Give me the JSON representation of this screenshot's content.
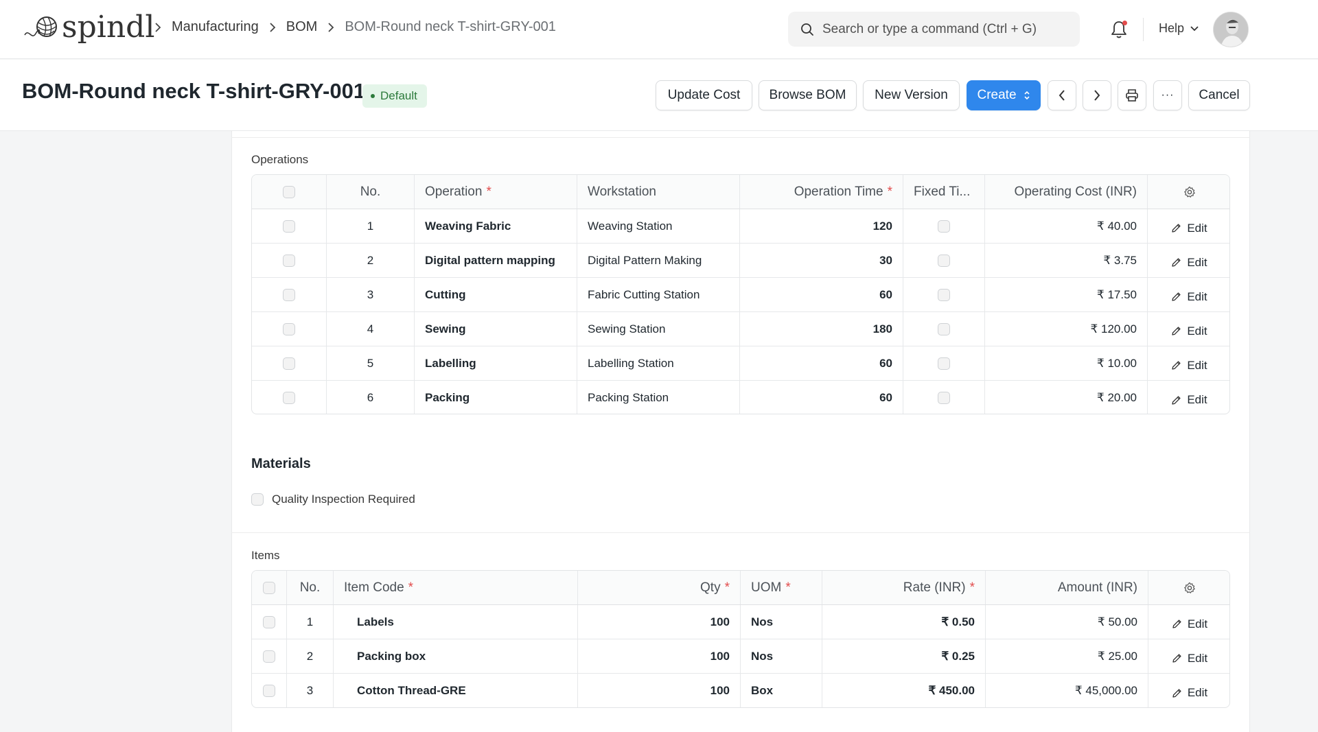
{
  "app": {
    "logo_text": "spindl"
  },
  "breadcrumbs": [
    "Manufacturing",
    "BOM",
    "BOM-Round neck T-shirt-GRY-001"
  ],
  "search": {
    "placeholder": "Search or type a command (Ctrl + G)"
  },
  "nav": {
    "help_label": "Help"
  },
  "header": {
    "title": "BOM-Round neck T-shirt-GRY-001",
    "status_badge": "Default",
    "buttons": {
      "update_cost": "Update Cost",
      "browse_bom": "Browse BOM",
      "new_version": "New Version",
      "create": "Create",
      "cancel": "Cancel",
      "more": "···"
    }
  },
  "operations": {
    "label": "Operations",
    "columns": {
      "no": "No.",
      "operation": "Operation",
      "workstation": "Workstation",
      "operation_time": "Operation Time",
      "fixed_time": "Fixed Ti...",
      "operating_cost": "Operating Cost (INR)"
    },
    "edit_label": "Edit",
    "rows": [
      {
        "no": "1",
        "operation": "Weaving Fabric",
        "workstation": "Weaving Station",
        "time": "120",
        "cost": "₹ 40.00"
      },
      {
        "no": "2",
        "operation": "Digital pattern mapping",
        "workstation": "Digital Pattern Making",
        "time": "30",
        "cost": "₹ 3.75"
      },
      {
        "no": "3",
        "operation": "Cutting",
        "workstation": "Fabric Cutting Station",
        "time": "60",
        "cost": "₹ 17.50"
      },
      {
        "no": "4",
        "operation": "Sewing",
        "workstation": "Sewing Station",
        "time": "180",
        "cost": "₹ 120.00"
      },
      {
        "no": "5",
        "operation": "Labelling",
        "workstation": "Labelling Station",
        "time": "60",
        "cost": "₹ 10.00"
      },
      {
        "no": "6",
        "operation": "Packing",
        "workstation": "Packing Station",
        "time": "60",
        "cost": "₹ 20.00"
      }
    ]
  },
  "materials": {
    "title": "Materials",
    "quality_inspection_label": "Quality Inspection Required"
  },
  "items": {
    "label": "Items",
    "columns": {
      "no": "No.",
      "item_code": "Item Code",
      "qty": "Qty",
      "uom": "UOM",
      "rate": "Rate (INR)",
      "amount": "Amount (INR)"
    },
    "edit_label": "Edit",
    "rows": [
      {
        "no": "1",
        "item_code": "Labels",
        "qty": "100",
        "uom": "Nos",
        "rate": "₹ 0.50",
        "amount": "₹ 50.00"
      },
      {
        "no": "2",
        "item_code": "Packing box",
        "qty": "100",
        "uom": "Nos",
        "rate": "₹ 0.25",
        "amount": "₹ 25.00"
      },
      {
        "no": "3",
        "item_code": "Cotton Thread-GRE",
        "qty": "100",
        "uom": "Box",
        "rate": "₹ 450.00",
        "amount": "₹ 45,000.00"
      }
    ]
  },
  "colors": {
    "primary": "#2f87ec",
    "required": "#e24c4c",
    "badge_bg": "#e4f5e9",
    "badge_text": "#2c7a3b"
  }
}
